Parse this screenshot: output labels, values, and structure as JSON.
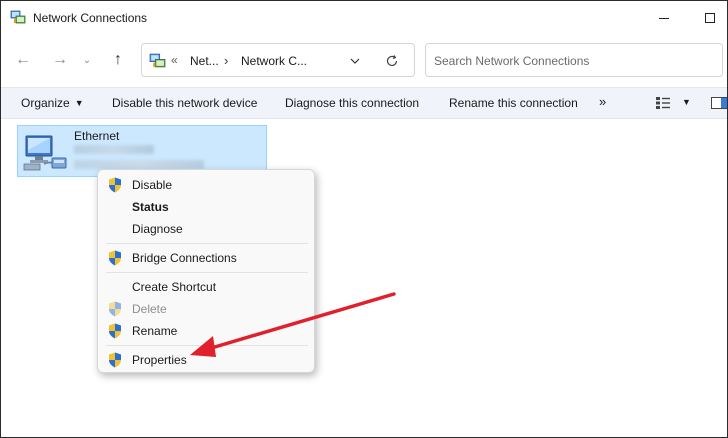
{
  "window": {
    "title": "Network Connections",
    "icon": "network-connections-icon",
    "controls": [
      "minimize-icon",
      "maximize-icon"
    ]
  },
  "address": {
    "overflow": "«",
    "segments": [
      "Net...",
      "Network C..."
    ],
    "separator": "›",
    "search_placeholder": "Search Network Connections",
    "nav": {
      "back": "←",
      "forward": "→",
      "recent": "⌄",
      "up": "↑"
    }
  },
  "commandbar": {
    "organize": "Organize",
    "disable": "Disable this network device",
    "diagnose": "Diagnose this connection",
    "rename": "Rename this connection",
    "more": "»"
  },
  "adapter": {
    "name": "Ethernet"
  },
  "context_menu": {
    "items": [
      {
        "label": "Disable",
        "shield": true,
        "bold": false,
        "disabled": false
      },
      {
        "label": "Status",
        "shield": false,
        "bold": true,
        "disabled": false
      },
      {
        "label": "Diagnose",
        "shield": false,
        "bold": false,
        "disabled": false
      },
      {
        "label": "Bridge Connections",
        "shield": true,
        "bold": false,
        "disabled": false
      },
      {
        "label": "Create Shortcut",
        "shield": false,
        "bold": false,
        "disabled": false
      },
      {
        "label": "Delete",
        "shield": true,
        "bold": false,
        "disabled": true
      },
      {
        "label": "Rename",
        "shield": true,
        "bold": false,
        "disabled": false
      },
      {
        "label": "Properties",
        "shield": true,
        "bold": false,
        "disabled": false
      }
    ]
  },
  "colors": {
    "selection_fill": "#cce8ff",
    "selection_border": "#99d1ff",
    "commandbar_bg": "#f0f3f9",
    "annotation_arrow": "#e0202a",
    "shield_blue": "#2a6fd6",
    "shield_yellow": "#f2c12e"
  }
}
